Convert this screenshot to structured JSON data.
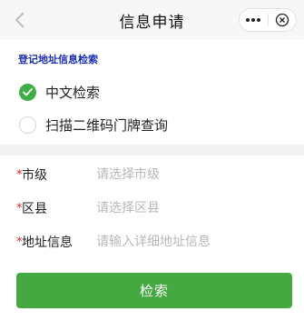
{
  "nav": {
    "title": "信息申请",
    "back_icon": "chevron-left-icon",
    "more_icon": "more-dots-icon",
    "close_icon": "close-circle-icon"
  },
  "section": {
    "title": "登记地址信息检索"
  },
  "search_mode": {
    "selected": "中文检索",
    "options": [
      {
        "label": "中文检索",
        "checked": true
      },
      {
        "label": "扫描二维码门牌查询",
        "checked": false
      }
    ]
  },
  "form": {
    "required_mark": "*",
    "fields": [
      {
        "label": "市级",
        "value": "",
        "placeholder": "请选择市级"
      },
      {
        "label": "区县",
        "value": "",
        "placeholder": "请选择区县"
      },
      {
        "label": "地址信息",
        "value": "",
        "placeholder": "请输入详细地址信息"
      }
    ]
  },
  "submit_label": "检索",
  "colors": {
    "accent_green": "#44a940",
    "section_title_blue": "#1a2fb5",
    "required_red": "#e02020"
  }
}
